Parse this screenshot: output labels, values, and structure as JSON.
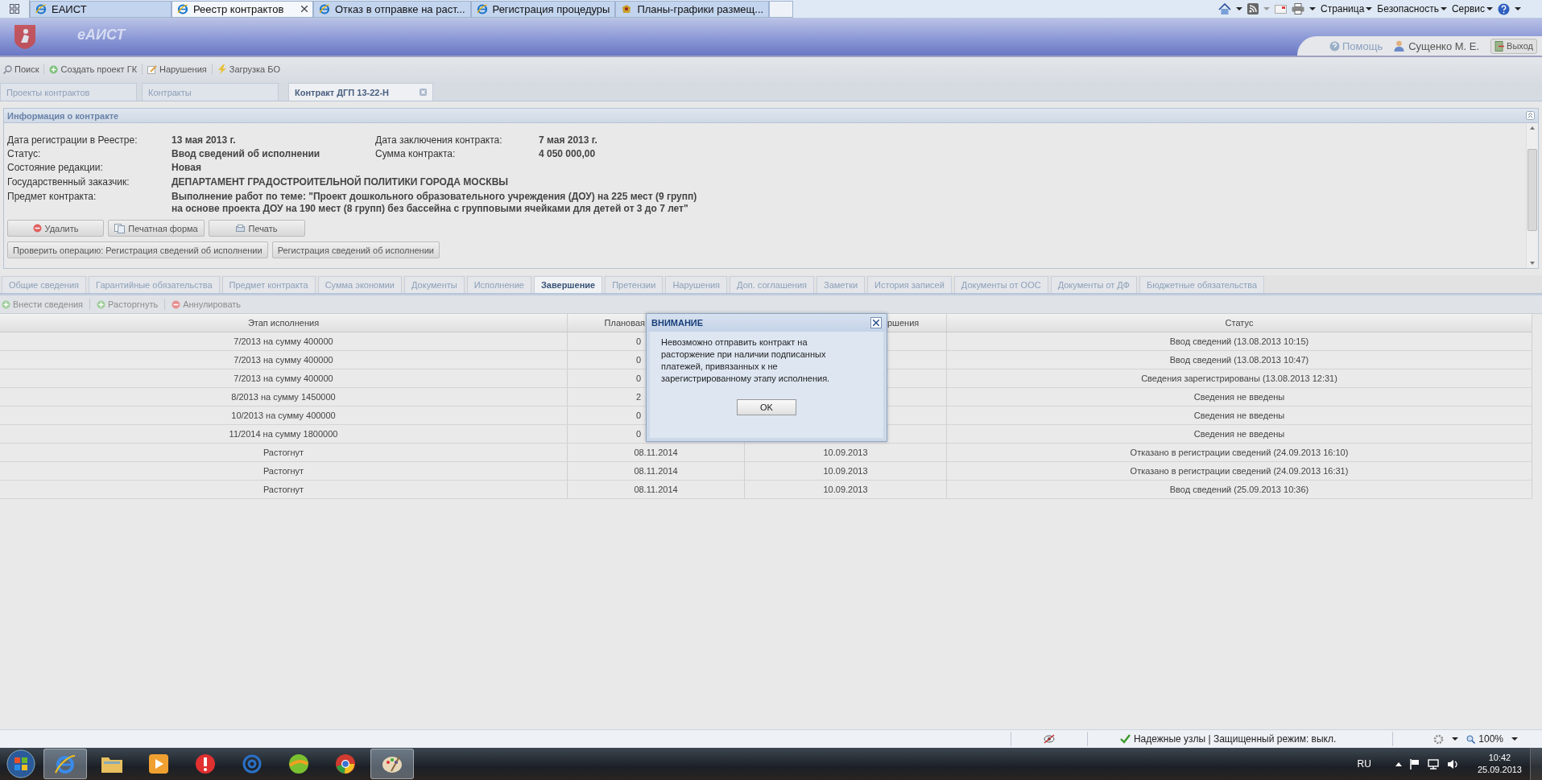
{
  "browser": {
    "tabs": [
      {
        "title": "ЕАИСТ",
        "selected": false,
        "closable": false,
        "kind": "ie"
      },
      {
        "title": "Реестр контрактов",
        "selected": true,
        "closable": true,
        "kind": "ie"
      },
      {
        "title": "Отказ в отправке на раст...",
        "selected": false,
        "closable": false,
        "kind": "ie"
      },
      {
        "title": "Регистрация процедуры",
        "selected": false,
        "closable": false,
        "kind": "ie"
      },
      {
        "title": "Планы-графики размещ...",
        "selected": false,
        "closable": false,
        "kind": "emblem"
      }
    ],
    "commands": [
      "Страница",
      "Безопасность",
      "Сервис"
    ]
  },
  "app": {
    "logo": "еАИСТ",
    "help": "Помощь",
    "user": "Сущенко М. Е.",
    "logout": "Выход"
  },
  "toolbar": [
    {
      "label": "Поиск",
      "kind": "search"
    },
    {
      "label": "Создать проект  ГК",
      "kind": "plus"
    },
    {
      "label": "Нарушения",
      "kind": "pencil"
    },
    {
      "label": "Загрузка БО",
      "kind": "bolt"
    }
  ],
  "doc_tabs": [
    {
      "label": "Проекты контрактов",
      "selected": false,
      "closable": false
    },
    {
      "label": "Контракты",
      "selected": false,
      "closable": false
    },
    {
      "label": "Контракт ДГП 13-22-Н",
      "selected": true,
      "closable": true
    }
  ],
  "info": {
    "title": "Информация о контракте",
    "rows": [
      {
        "label": "Дата регистрации в Реестре:",
        "value": "13 мая 2013 г.",
        "label2": "Дата заключения контракта:",
        "value2": "7 мая 2013 г."
      },
      {
        "label": "Статус:",
        "value": "Ввод сведений об исполнении",
        "label2": "Сумма контракта:",
        "value2": "4 050 000,00"
      },
      {
        "label": "Состояние редакции:",
        "value": "Новая"
      },
      {
        "label": "Государственный заказчик:",
        "value": "ДЕПАРТАМЕНТ ГРАДОСТРОИТЕЛЬНОЙ ПОЛИТИКИ ГОРОДА МОСКВЫ"
      },
      {
        "label": "Предмет контракта:",
        "value": "Выполнение работ по теме: \"Проект дошкольного образовательного учреждения (ДОУ) на 225 мест (9 групп)\nна основе проекта ДОУ на 190 мест (8 групп) без бассейна с групповыми ячейками для детей от 3 до 7 лет\""
      }
    ],
    "buttons": [
      {
        "label": "Удалить",
        "kind": "delete"
      },
      {
        "label": "Печатная форма",
        "kind": "pages"
      },
      {
        "label": "Печать",
        "kind": "print"
      }
    ],
    "operations": [
      "Проверить операцию: Регистрация сведений об исполнении",
      "Регистрация сведений об исполнении"
    ]
  },
  "section_tabs": [
    {
      "label": "Общие сведения",
      "selected": false
    },
    {
      "label": "Гарантийные обязательства",
      "selected": false
    },
    {
      "label": "Предмет контракта",
      "selected": false
    },
    {
      "label": "Сумма экономии",
      "selected": false
    },
    {
      "label": "Документы",
      "selected": false
    },
    {
      "label": "Исполнение",
      "selected": false
    },
    {
      "label": "Завершение",
      "selected": true
    },
    {
      "label": "Претензии",
      "selected": false
    },
    {
      "label": "Нарушения",
      "selected": false
    },
    {
      "label": "Доп. соглашения",
      "selected": false
    },
    {
      "label": "Заметки",
      "selected": false
    },
    {
      "label": "История записей",
      "selected": false
    },
    {
      "label": "Документы от ООС",
      "selected": false
    },
    {
      "label": "Документы от ДФ",
      "selected": false
    },
    {
      "label": "Бюджетные обязательства",
      "selected": false
    }
  ],
  "actions": [
    {
      "label": "Внести сведения",
      "kind": "add",
      "disabled": true
    },
    {
      "label": "Расторгнуть",
      "kind": "add",
      "disabled": true
    },
    {
      "label": "Аннулировать",
      "kind": "remove",
      "disabled": true
    }
  ],
  "table": {
    "columns": [
      "Этап исполнения",
      "Плановая",
      "ршения",
      "Статус"
    ],
    "rows": [
      {
        "cells": [
          "7/2013 на сумму 400000",
          "0",
          "",
          "Ввод сведений (13.08.2013 10:15)"
        ],
        "covered": true
      },
      {
        "cells": [
          "7/2013 на сумму 400000",
          "0",
          "",
          "Ввод сведений (13.08.2013 10:47)"
        ],
        "covered": true
      },
      {
        "cells": [
          "7/2013 на сумму 400000",
          "0",
          "",
          "Сведения зарегистрированы (13.08.2013 12:31)"
        ],
        "covered": true
      },
      {
        "cells": [
          "8/2013 на сумму 1450000",
          "2",
          "",
          "Сведения не введены"
        ],
        "covered": true
      },
      {
        "cells": [
          "10/2013 на сумму 400000",
          "0",
          "",
          "Сведения не введены"
        ],
        "covered": true
      },
      {
        "cells": [
          "11/2014 на сумму 1800000",
          "0",
          "",
          "Сведения не введены"
        ],
        "covered": true
      },
      {
        "cells": [
          "Растогнут",
          "08.11.2014",
          "10.09.2013",
          "Отказано в регистрации сведений (24.09.2013 16:10)"
        ],
        "covered": false
      },
      {
        "cells": [
          "Растогнут",
          "08.11.2014",
          "10.09.2013",
          "Отказано в регистрации сведений (24.09.2013 16:31)"
        ],
        "covered": false
      },
      {
        "cells": [
          "Растогнут",
          "08.11.2014",
          "10.09.2013",
          "Ввод сведений (25.09.2013 10:36)"
        ],
        "covered": false
      }
    ]
  },
  "dialog": {
    "title": "ВНИМАНИЕ",
    "message": "Невозможно отправить контракт на\nрасторжение при наличии подписанных\nплатежей, привязанных к не\nзарегистрированному этапу исполнения.",
    "button": "OK"
  },
  "status_bar": {
    "security": "Надежные узлы | Защищенный режим: выкл.",
    "zoom": "100%"
  },
  "taskbar": {
    "apps": [
      {
        "kind": "ie",
        "active": true
      },
      {
        "kind": "folder",
        "active": false
      },
      {
        "kind": "media",
        "active": false
      },
      {
        "kind": "redapp",
        "active": false
      },
      {
        "kind": "mail",
        "active": false
      },
      {
        "kind": "ball",
        "active": false
      },
      {
        "kind": "chrome",
        "active": false
      },
      {
        "kind": "paint",
        "active": true
      }
    ],
    "language": "RU",
    "time": "10:42",
    "date": "25.09.2013"
  }
}
